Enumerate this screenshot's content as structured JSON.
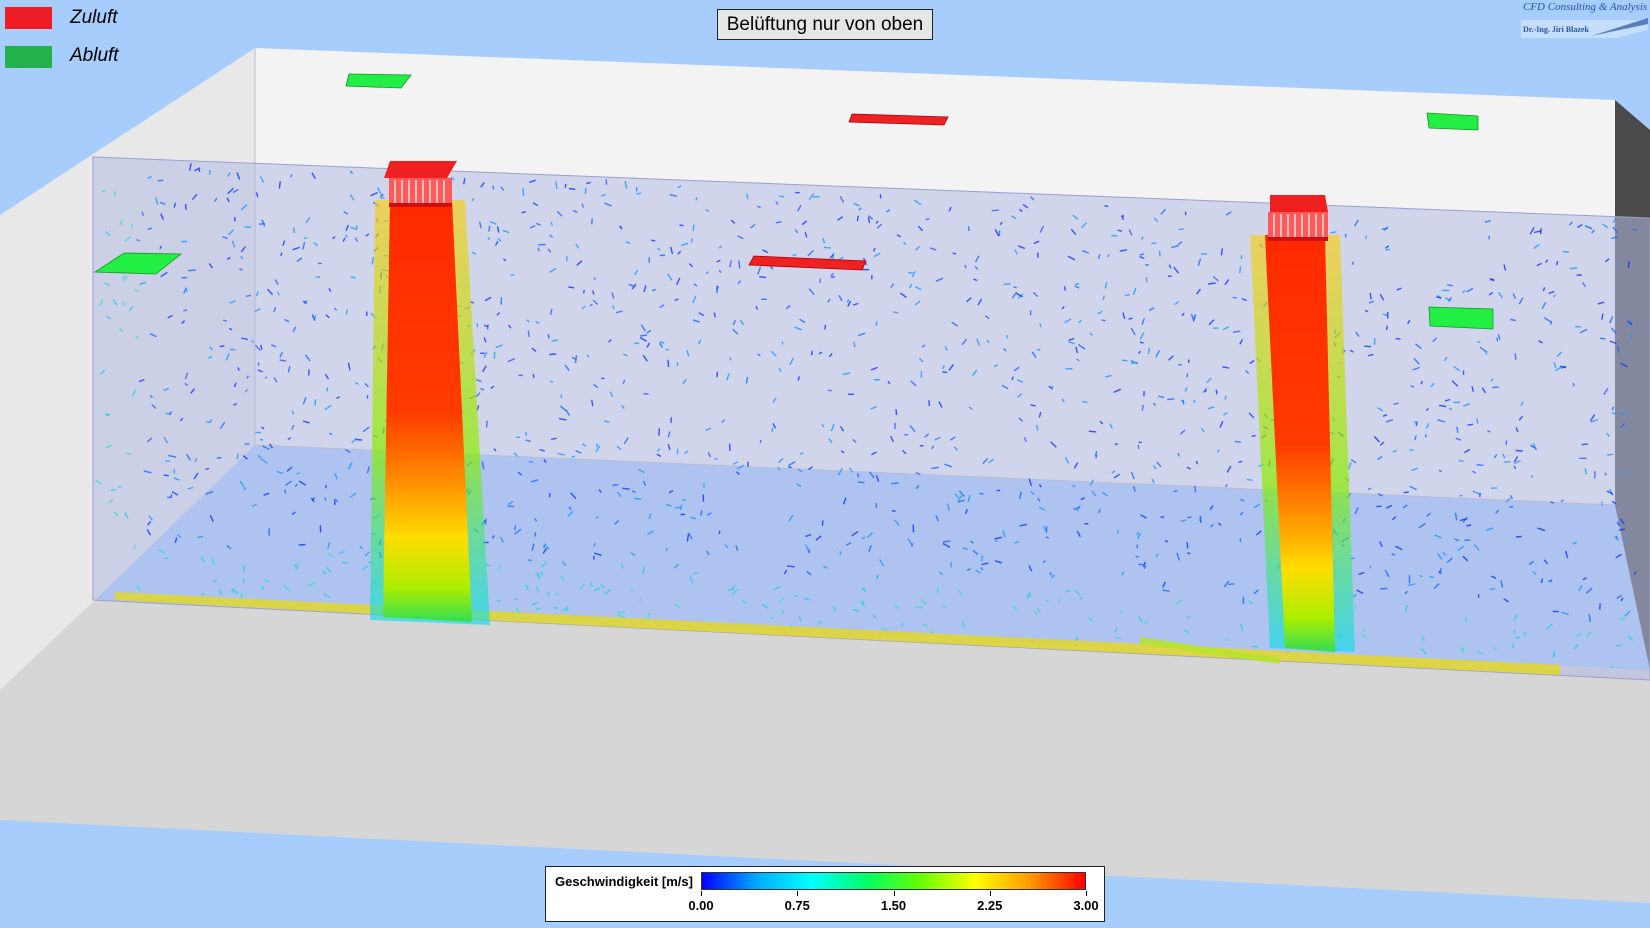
{
  "title": "Belüftung nur von oben",
  "legend": [
    {
      "label": "Zuluft",
      "color": "#ed1c24"
    },
    {
      "label": "Abluft",
      "color": "#22b14c"
    }
  ],
  "logo": {
    "line1": "CFD Consulting & Analysis",
    "line2": "Dr.-Ing. Jiri Blazek"
  },
  "colorbar": {
    "label": "Geschwindigkeit [m/s]",
    "ticks": [
      "0.00",
      "0.75",
      "1.50",
      "2.25",
      "3.00"
    ],
    "min": 0,
    "max": 3,
    "colors": [
      "#0000ff",
      "#00aaff",
      "#00ffff",
      "#00ff66",
      "#66ff00",
      "#ffff00",
      "#ff9900",
      "#ff0000"
    ]
  },
  "colors": {
    "supply": "#ee2222",
    "exhaust": "#22ee44",
    "background": "#a6cdfb"
  }
}
